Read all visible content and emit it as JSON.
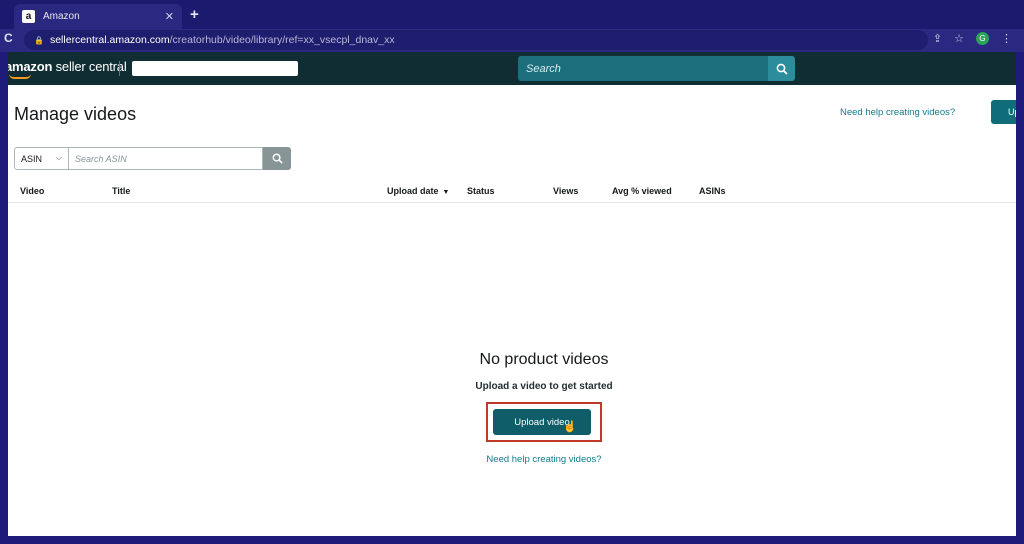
{
  "browser": {
    "tab_title": "Amazon",
    "favicon": "a",
    "url_domain": "sellercentral.amazon.com",
    "url_path": "/creatorhub/video/library/ref=xx_vsecpl_dnav_xx"
  },
  "header": {
    "logo_amazon": "amazon",
    "logo_suffix": " seller central",
    "search_placeholder": "Search"
  },
  "page": {
    "title": "Manage videos",
    "help_link_top": "Need help creating videos?",
    "upload_top_label": "Up"
  },
  "filter": {
    "select_value": "ASIN",
    "search_placeholder": "Search ASIN"
  },
  "table": {
    "columns": [
      "Video",
      "Title",
      "Upload date",
      "Status",
      "Views",
      "Avg % viewed",
      "ASINs"
    ]
  },
  "empty_state": {
    "title": "No product videos",
    "subtitle": "Upload a video to get started",
    "button_label": "Upload video",
    "help_link": "Need help creating videos?"
  },
  "colors": {
    "frame": "#1e1b7a",
    "header_bg": "#0f2d33",
    "primary_button": "#0f5d68",
    "link": "#127c8c",
    "highlight": "#c0392b"
  }
}
